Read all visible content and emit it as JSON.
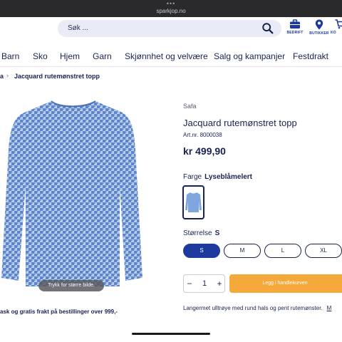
{
  "browser": {
    "url": "sparkjop.no"
  },
  "header": {
    "search_placeholder": "Søk ...",
    "icons": [
      {
        "name": "briefcase-icon",
        "label": "BEDRIFT"
      },
      {
        "name": "location-pin-icon",
        "label": "BUTIKKER"
      },
      {
        "name": "cart-icon",
        "label": "KO"
      }
    ]
  },
  "nav": {
    "items": [
      "Barn",
      "Sko",
      "Hjem",
      "Garn",
      "Skjønnhet og velvære",
      "Salg og kampanjer",
      "Festdrakt"
    ]
  },
  "breadcrumb": {
    "first": "a",
    "current": "Jacquard rutemønstret topp"
  },
  "product": {
    "brand": "Safa",
    "title": "Jacquard rutemønstret topp",
    "art_nr": "Art.nr. 8000038",
    "price": "kr 499,90",
    "color_label": "Farge",
    "color_value": "Lyseblåmelert",
    "size_label": "Størrelse",
    "size_value": "S",
    "sizes": [
      "S",
      "M",
      "L",
      "XL"
    ],
    "selected_size": "S",
    "quantity": "1",
    "add_to_cart": "Legg i handlekurven",
    "description": "Langermet ulltrøye med rund hals og pent rutemønster.",
    "description_more": "M",
    "image_tooltip": "Trykk for større bilde."
  },
  "promo": "ask og gratis frakt på bestillinger over 999,-",
  "colors": {
    "navy": "#1a2350",
    "accent_blue": "#1e3a9e",
    "cta_orange": "#f5a93a",
    "fabric_blue": "#7fa6dc"
  }
}
